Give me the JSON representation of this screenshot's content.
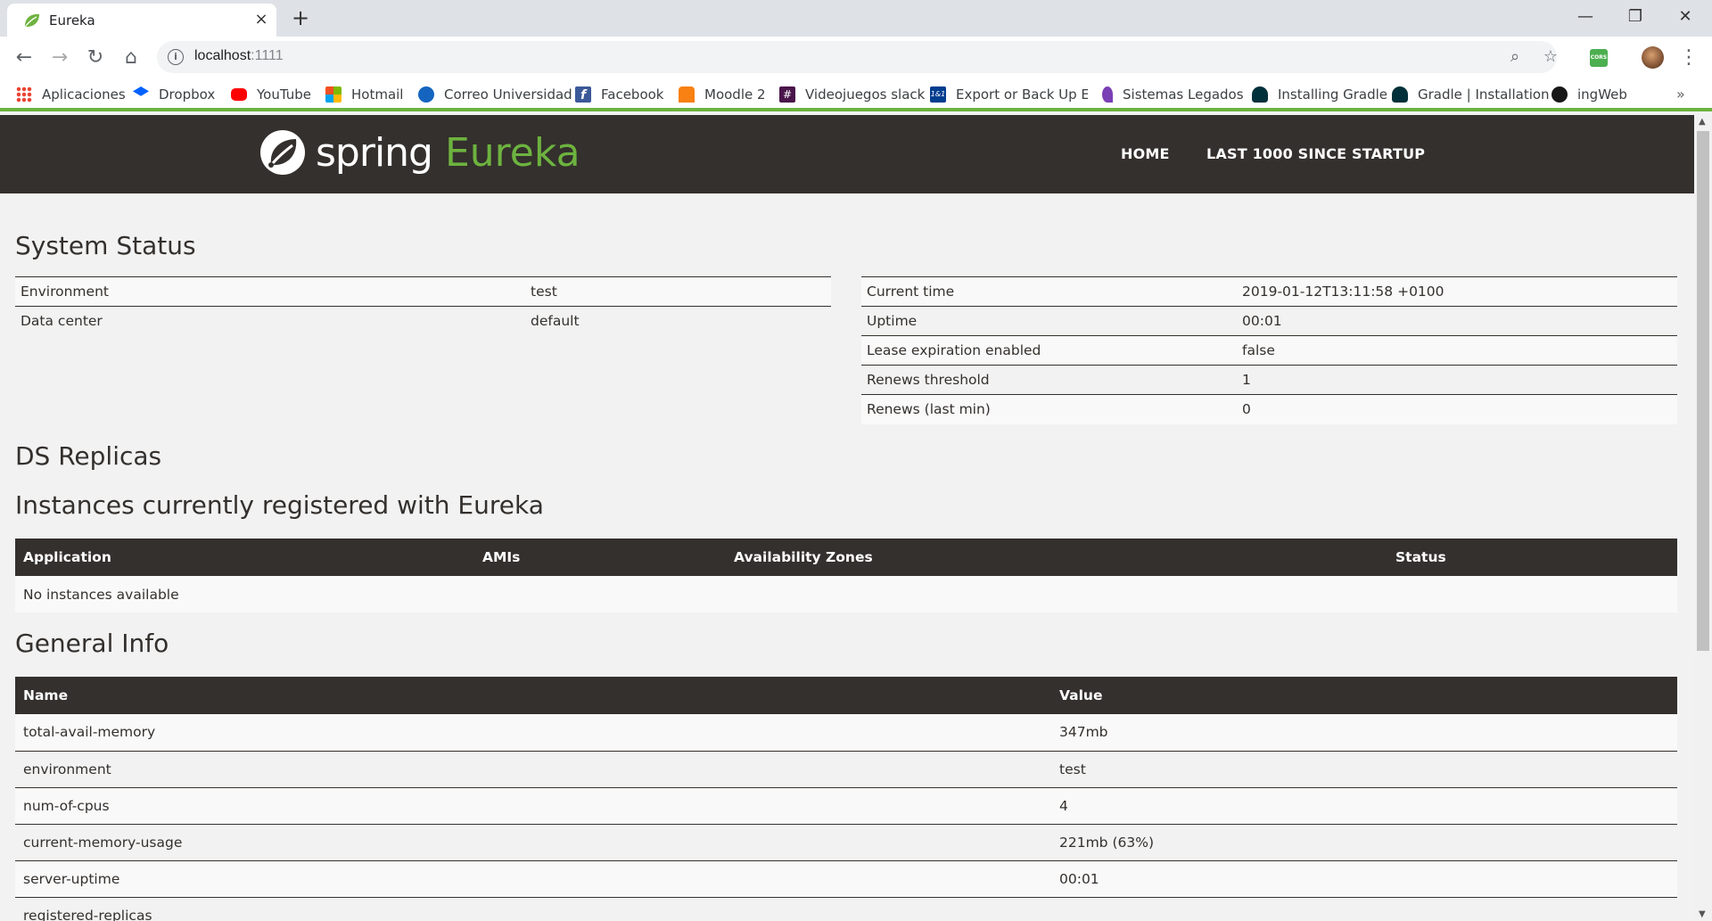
{
  "browser": {
    "tab_title": "Eureka",
    "tab_close": "×",
    "new_tab": "+",
    "window_controls": {
      "minimize": "—",
      "maximize": "❐",
      "close": "✕"
    },
    "back": "←",
    "forward": "→",
    "reload": "↻",
    "home": "⌂",
    "url_host": "localhost",
    "url_port": ":1111",
    "info_icon": "i",
    "zoom_icon": "⌕",
    "star_icon": "☆",
    "cors_ext": "CORS",
    "menu": "⋮",
    "bookmarks": [
      {
        "label": "Aplicaciones",
        "icon": "apps-icon",
        "color": "#ea4335"
      },
      {
        "label": "Dropbox",
        "icon": "dropbox-icon",
        "color": "#0061ff"
      },
      {
        "label": "YouTube",
        "icon": "youtube-icon",
        "color": "#ff0000"
      },
      {
        "label": "Hotmail",
        "icon": "microsoft-icon",
        "color": "#f25022"
      },
      {
        "label": "Correo Universidad",
        "icon": "mail-icon",
        "color": "#1565c0"
      },
      {
        "label": "Facebook",
        "icon": "facebook-icon",
        "color": "#3b5998"
      },
      {
        "label": "Moodle 2",
        "icon": "moodle-icon",
        "color": "#f98012"
      },
      {
        "label": "Videojuegos slack",
        "icon": "slack-icon",
        "color": "#4a154b"
      },
      {
        "label": "Export or Back Up Em",
        "icon": "1and1-icon",
        "color": "#003d8f"
      },
      {
        "label": "Sistemas Legados",
        "icon": "legados-icon",
        "color": "#7b3fb5"
      },
      {
        "label": "Installing Gradle",
        "icon": "gradle-icon",
        "color": "#02303a"
      },
      {
        "label": "Gradle | Installation",
        "icon": "gradle-icon",
        "color": "#02303a"
      },
      {
        "label": "ingWeb",
        "icon": "github-icon",
        "color": "#181717"
      }
    ],
    "bookmarks_more": "»"
  },
  "header": {
    "logo_spring": "spring",
    "logo_eureka": "Eureka",
    "nav": [
      "HOME",
      "LAST 1000 SINCE STARTUP"
    ]
  },
  "system_status": {
    "title": "System Status",
    "left": [
      {
        "label": "Environment",
        "value": "test"
      },
      {
        "label": "Data center",
        "value": "default"
      }
    ],
    "right": [
      {
        "label": "Current time",
        "value": "2019-01-12T13:11:58 +0100"
      },
      {
        "label": "Uptime",
        "value": "00:01"
      },
      {
        "label": "Lease expiration enabled",
        "value": "false"
      },
      {
        "label": "Renews threshold",
        "value": "1"
      },
      {
        "label": "Renews (last min)",
        "value": "0"
      }
    ]
  },
  "ds_replicas": {
    "title": "DS Replicas"
  },
  "instances": {
    "title": "Instances currently registered with Eureka",
    "columns": [
      "Application",
      "AMIs",
      "Availability Zones",
      "Status"
    ],
    "empty_text": "No instances available"
  },
  "general_info": {
    "title": "General Info",
    "columns": [
      "Name",
      "Value"
    ],
    "rows": [
      {
        "name": "total-avail-memory",
        "value": "347mb"
      },
      {
        "name": "environment",
        "value": "test"
      },
      {
        "name": "num-of-cpus",
        "value": "4"
      },
      {
        "name": "current-memory-usage",
        "value": "221mb (63%)"
      },
      {
        "name": "server-uptime",
        "value": "00:01"
      },
      {
        "name": "registered-replicas",
        "value": ""
      }
    ]
  },
  "colors": {
    "brand_dark": "#34302d",
    "brand_green": "#6db33f"
  }
}
